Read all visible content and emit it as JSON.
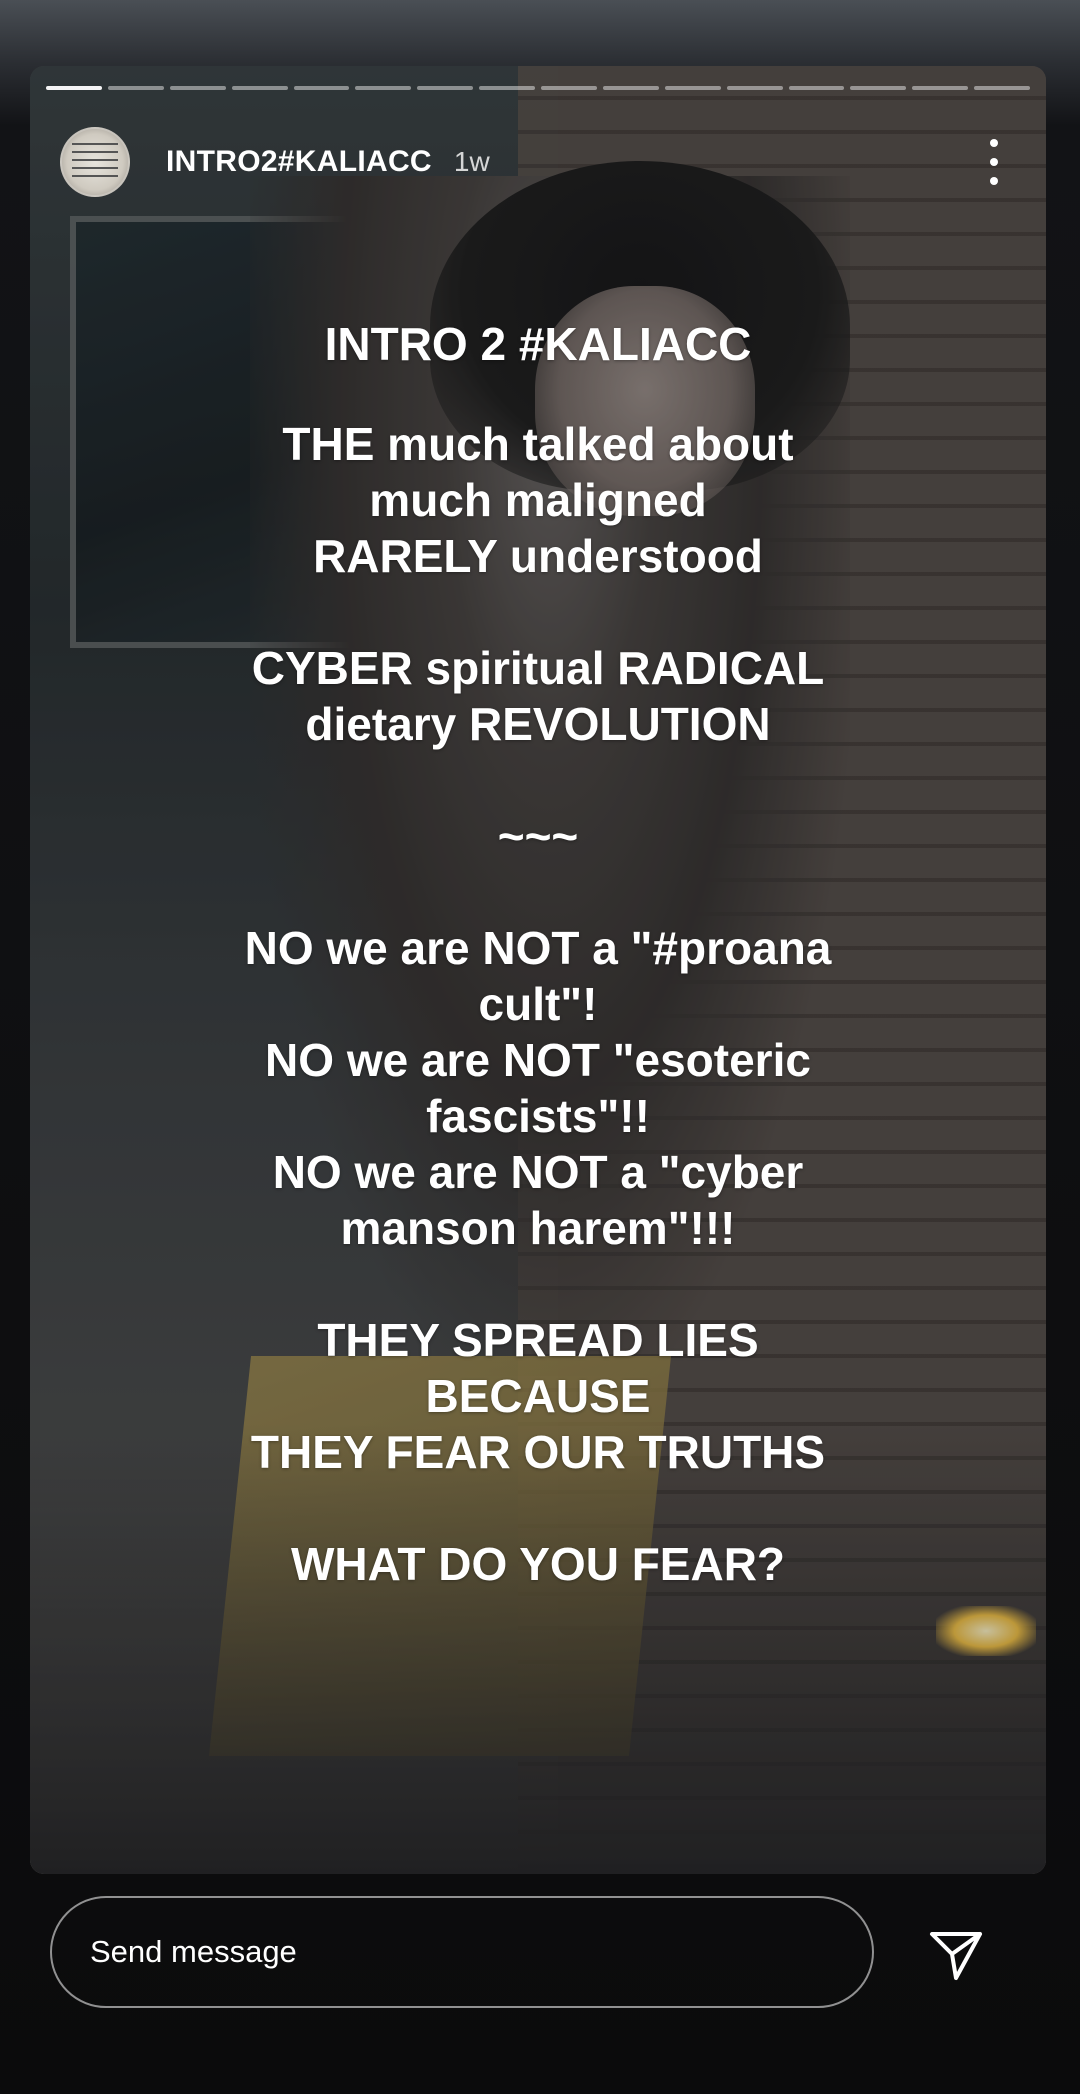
{
  "story": {
    "progress": {
      "total": 16,
      "current": 1
    },
    "header": {
      "username": "INTRO2#KALIACC",
      "time": "1w"
    },
    "text": {
      "title": "INTRO 2 #KALIACC",
      "block1": [
        "THE much talked about",
        "much maligned",
        "RARELY understood"
      ],
      "block2": [
        "CYBER spiritual RADICAL",
        "dietary REVOLUTION"
      ],
      "divider": "~~~",
      "block3": [
        "NO we are NOT a \"#proana",
        "cult\"!",
        "NO we are NOT \"esoteric",
        "fascists\"!!",
        "NO we are NOT a \"cyber",
        "manson harem\"!!!"
      ],
      "block4": [
        "THEY SPREAD LIES",
        "BECAUSE",
        "THEY FEAR OUR TRUTHS"
      ],
      "closing": "WHAT DO YOU FEAR?"
    }
  },
  "reply": {
    "placeholder": "Send message",
    "send_icon": "paper-plane-icon",
    "more_icon": "vertical-dots-icon"
  }
}
